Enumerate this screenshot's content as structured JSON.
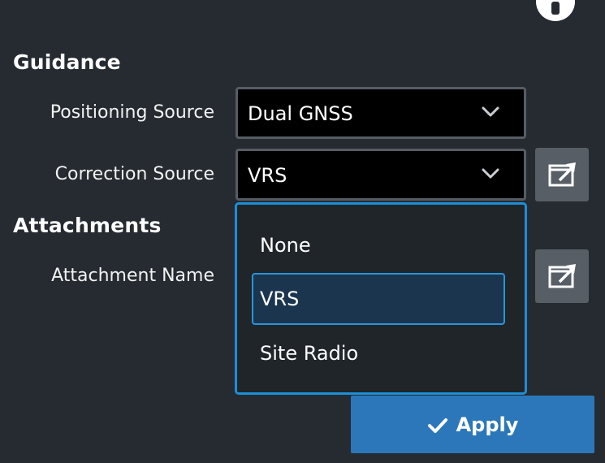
{
  "guidance": {
    "title": "Guidance",
    "positioning_label": "Positioning Source",
    "positioning_value": "Dual GNSS",
    "correction_label": "Correction Source",
    "correction_value": "VRS"
  },
  "attachments": {
    "title": "Attachments",
    "name_label": "Attachment Name"
  },
  "dropdown": {
    "options": [
      "None",
      "VRS",
      "Site Radio"
    ],
    "selected": "VRS"
  },
  "apply": {
    "label": "Apply"
  },
  "icons": {
    "info": "info-icon",
    "chevron": "chevron-down-icon",
    "open_external": "open-external-icon",
    "check": "check-icon"
  },
  "colors": {
    "background": "#262b31",
    "accent": "#1c8fd8",
    "apply": "#2c77ba",
    "selected_option": "#1b354f"
  }
}
